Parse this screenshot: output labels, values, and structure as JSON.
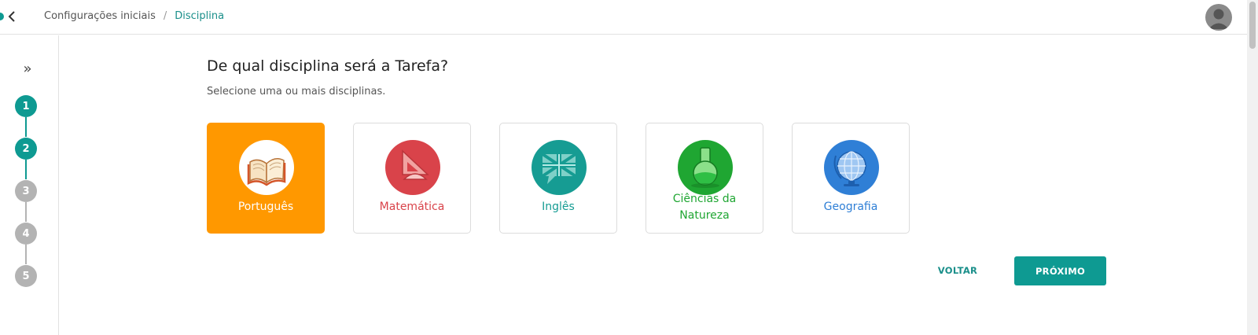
{
  "header": {
    "breadcrumb": [
      "Configurações iniciais",
      "Disciplina"
    ],
    "separator": "/"
  },
  "sidebar": {
    "expand_icon": "»",
    "steps": [
      {
        "label": "1",
        "state": "active"
      },
      {
        "label": "2",
        "state": "active"
      },
      {
        "label": "3",
        "state": "inactive"
      },
      {
        "label": "4",
        "state": "inactive"
      },
      {
        "label": "5",
        "state": "inactive"
      }
    ]
  },
  "main": {
    "title": "De qual disciplina será a Tarefa?",
    "subtitle": "Selecione uma ou mais disciplinas.",
    "subjects": [
      {
        "name": "Português",
        "icon": "open-book-icon",
        "color": "#ffffff",
        "selected": true
      },
      {
        "name": "Matemática",
        "icon": "set-square-icon",
        "color": "#d9434a",
        "selected": false
      },
      {
        "name": "Inglês",
        "icon": "uk-flag-speech-bubble-icon",
        "color": "#169c93",
        "selected": false
      },
      {
        "name": "Ciências da Natureza",
        "icon": "flask-icon",
        "color": "#1fa632",
        "selected": false
      },
      {
        "name": "Geografia",
        "icon": "globe-icon",
        "color": "#2f7fd6",
        "selected": false
      }
    ]
  },
  "actions": {
    "back_label": "VOLTAR",
    "next_label": "PRÓXIMO"
  },
  "colors": {
    "accent": "#0e9a92",
    "selected_card": "#ff9800",
    "inactive_step": "#b3b3b3"
  }
}
